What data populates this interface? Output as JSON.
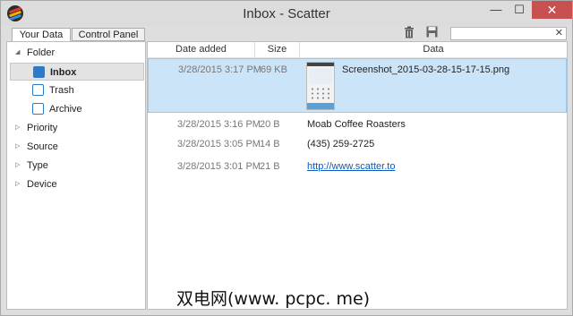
{
  "window": {
    "title": "Inbox - Scatter"
  },
  "controls": {
    "minimize": "—",
    "maximize": "☐",
    "close": "✕"
  },
  "tabs": [
    {
      "label": "Your Data"
    },
    {
      "label": "Control Panel"
    }
  ],
  "toolbar": {
    "trash_icon": "trash-icon",
    "save_icon": "save-icon"
  },
  "search": {
    "value": "",
    "clear": "✕"
  },
  "sidebar": {
    "folder": {
      "label": "Folder",
      "arrow": "◢"
    },
    "folder_children": [
      {
        "label": "Inbox",
        "icon": "inbox-icon",
        "selected": true
      },
      {
        "label": "Trash",
        "icon": "trash-icon",
        "selected": false
      },
      {
        "label": "Archive",
        "icon": "archive-icon",
        "selected": false
      }
    ],
    "groups": [
      {
        "label": "Priority",
        "arrow": "▷"
      },
      {
        "label": "Source",
        "arrow": "▷"
      },
      {
        "label": "Type",
        "arrow": "▷"
      },
      {
        "label": "Device",
        "arrow": "▷"
      }
    ]
  },
  "table": {
    "headers": {
      "date": "Date added",
      "size": "Size",
      "data": "Data"
    },
    "rows": [
      {
        "date": "3/28/2015 3:17 PM",
        "size": "69 KB",
        "data": "Screenshot_2015-03-28-15-17-15.png",
        "kind": "image"
      },
      {
        "date": "3/28/2015 3:16 PM",
        "size": "20 B",
        "data": "Moab Coffee Roasters",
        "kind": "text"
      },
      {
        "date": "3/28/2015 3:05 PM",
        "size": "14 B",
        "data": "(435) 259-2725",
        "kind": "text"
      },
      {
        "date": "3/28/2015 3:01 PM",
        "size": "21 B",
        "data": "http://www.scatter.to",
        "kind": "link"
      }
    ]
  },
  "watermark": "双电网(www. pcpc. me)",
  "colors": {
    "selection": "#cce4f8",
    "link": "#0b5bc2",
    "close_button": "#c75050",
    "folder_icon": "#2d7bc7"
  }
}
